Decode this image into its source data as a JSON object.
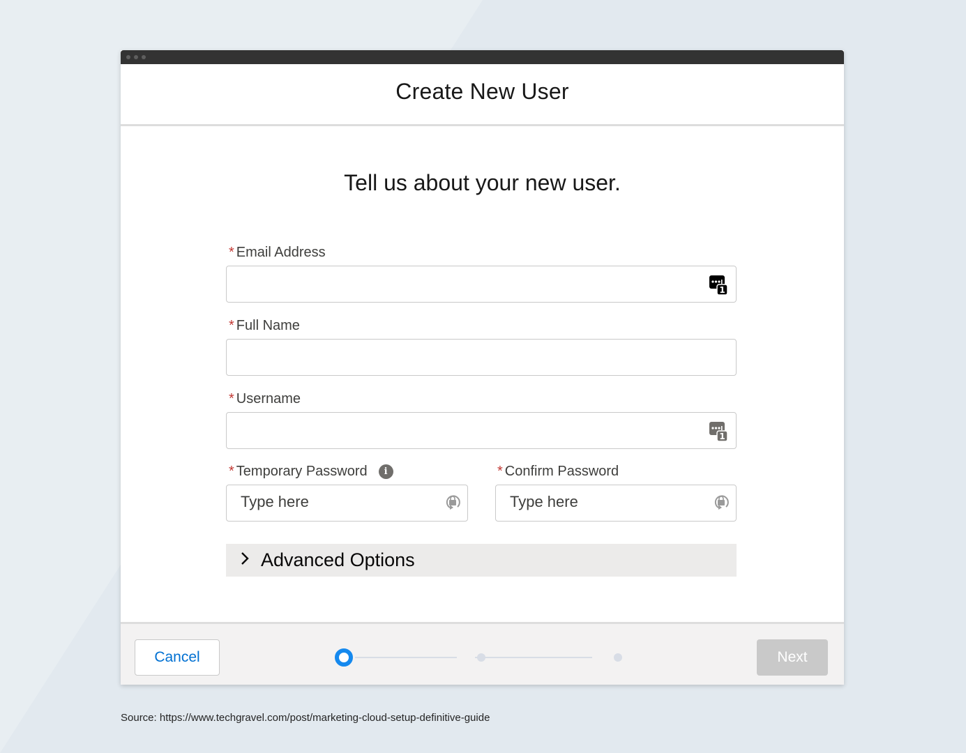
{
  "window": {
    "title": "Create New User",
    "subtitle": "Tell us about your new user."
  },
  "form": {
    "required_marker": "*",
    "email": {
      "label": "Email Address",
      "value": "",
      "icon": "password-manager-icon"
    },
    "full_name": {
      "label": "Full Name",
      "value": ""
    },
    "username": {
      "label": "Username",
      "value": "",
      "icon": "password-manager-icon"
    },
    "temp_password": {
      "label": "Temporary Password",
      "placeholder": "Type here",
      "info_icon": "info-icon",
      "icon": "lock-refresh-icon"
    },
    "confirm_password": {
      "label": "Confirm Password",
      "placeholder": "Type here",
      "icon": "lock-refresh-icon"
    },
    "advanced": {
      "label": "Advanced Options",
      "expanded": false,
      "icon": "chevron-right-icon"
    }
  },
  "footer": {
    "cancel_label": "Cancel",
    "next_label": "Next",
    "progress": {
      "total_steps": 3,
      "current_step": 1
    }
  },
  "source_note": "Source: https://www.techgravel.com/post/marketing-cloud-setup-definitive-guide",
  "colors": {
    "accent": "#0070d2",
    "progress_active": "#1589ee",
    "required": "#c23934",
    "disabled_button": "#c9c9c9"
  }
}
